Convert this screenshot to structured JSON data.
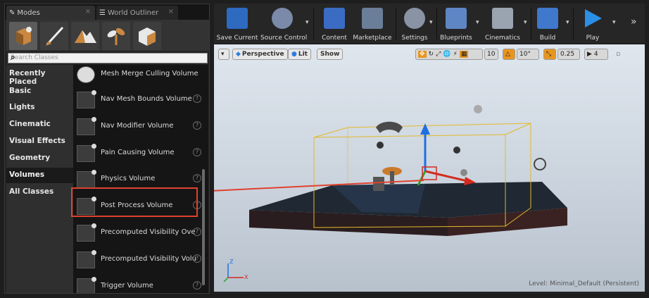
{
  "tabs": [
    {
      "label": "Modes",
      "icon": "modes-icon"
    },
    {
      "label": "World Outliner",
      "icon": "outliner-icon"
    }
  ],
  "modes": [
    "place-mode-icon",
    "paint-mode-icon",
    "landscape-mode-icon",
    "foliage-mode-icon",
    "geometry-edit-mode-icon"
  ],
  "search": {
    "placeholder": "Search Classes"
  },
  "categories": [
    "Recently Placed",
    "Basic",
    "Lights",
    "Cinematic",
    "Visual Effects",
    "Geometry",
    "Volumes",
    "All Classes"
  ],
  "active_category": "Volumes",
  "items": [
    "Mesh Merge Culling Volume",
    "Nav Mesh Bounds Volume",
    "Nav Modifier Volume",
    "Pain Causing Volume",
    "Physics Volume",
    "Post Process Volume",
    "Precomputed Visibility Ove",
    "Precomputed Visibility Volu",
    "Trigger Volume"
  ],
  "highlighted_item": "Post Process Volume",
  "toolbar": [
    {
      "label": "Save Current",
      "icon": "save-icon",
      "color": "#2d6ac0"
    },
    {
      "label": "Source Control",
      "icon": "source-control-icon",
      "color": "#7a8aa8"
    },
    {
      "label": "Content",
      "icon": "content-icon",
      "color": "#3b6cc4"
    },
    {
      "label": "Marketplace",
      "icon": "marketplace-icon",
      "color": "#6a7d99"
    },
    {
      "label": "Settings",
      "icon": "settings-icon",
      "color": "#8a93a3"
    },
    {
      "label": "Blueprints",
      "icon": "blueprints-icon",
      "color": "#5f86c4"
    },
    {
      "label": "Cinematics",
      "icon": "cinematics-icon",
      "color": "#9aa3b0"
    },
    {
      "label": "Build",
      "icon": "build-icon",
      "color": "#3f78cc"
    },
    {
      "label": "Play",
      "icon": "play-icon",
      "color": "#2b8fe6"
    }
  ],
  "overflow": "»",
  "viewport": {
    "perspective": "Perspective",
    "lit": "Lit",
    "show": "Show",
    "grid_snap": "10",
    "rot_snap": "10°",
    "scale_snap": "0.25",
    "camera_speed": "4",
    "level_label": "Level:",
    "level_name": "Minimal_Default (Persistent)",
    "axis_z": "Z",
    "axis_x": "X"
  }
}
